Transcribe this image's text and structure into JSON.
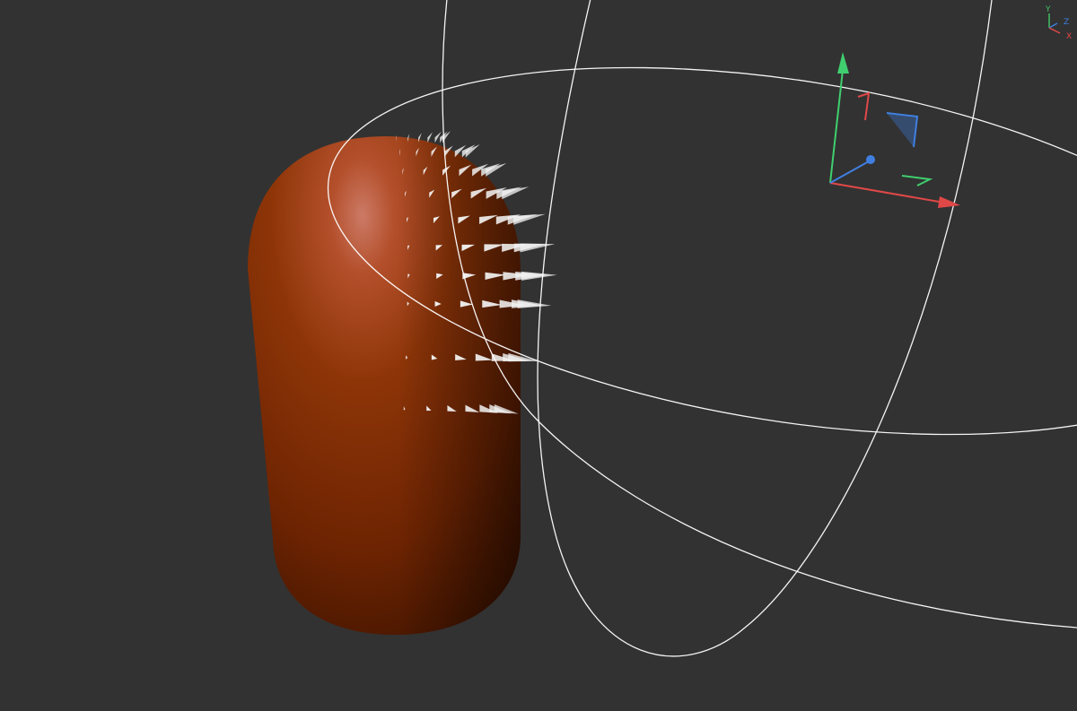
{
  "viewport": {
    "background": "#323232",
    "object": "capsule",
    "object_color": "#8e2f02",
    "spike_color": "#f2f2f2",
    "wireframe_color": "#ffffff"
  },
  "view_axes": {
    "labels": {
      "y": "Y",
      "z": "Z",
      "x": "X"
    },
    "colors": {
      "x": "#e04848",
      "y": "#3fbf5f",
      "z": "#3f7fe0"
    }
  },
  "gizmo": {
    "type": "transform-gizmo",
    "colors": {
      "x": "#e04848",
      "y": "#3fcf6f",
      "z": "#3f7fe0"
    }
  }
}
